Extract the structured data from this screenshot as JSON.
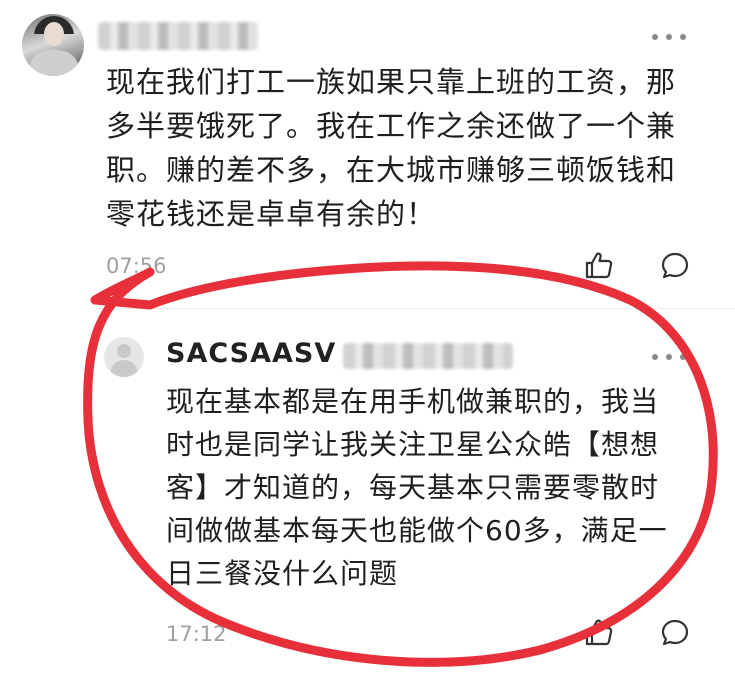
{
  "comment": {
    "text": "现在我们打工一族如果只靠上班的工资，那多半要饿死了。我在工作之余还做了一个兼职。赚的差不多，在大城市赚够三顿饭钱和零花钱还是卓卓有余的！",
    "time": "07:56"
  },
  "reply": {
    "username": "SACSAASV",
    "text": "现在基本都是在用手机做兼职的，我当时也是同学让我关注卫星公众皓【想想客】才知道的，每天基本只需要零散时间做做基本每天也能做个60多，满足一日三餐没什么问题",
    "time": "17:12"
  },
  "icons": {
    "more": "more-dots-icon",
    "like": "thumbs-up-icon",
    "reply": "comment-bubble-icon"
  },
  "colors": {
    "annotation_circle": "#e8303a",
    "meta_text": "#a0a0a0"
  }
}
